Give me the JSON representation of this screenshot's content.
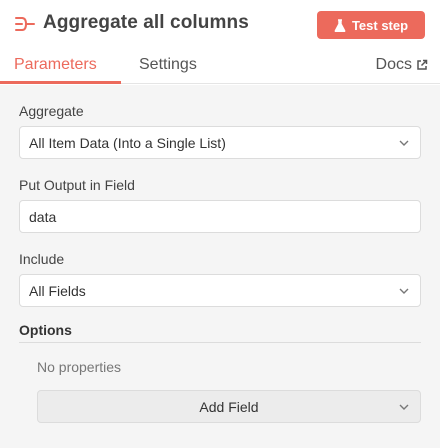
{
  "node": {
    "title": "Aggregate all columns",
    "icon": "aggregate-icon",
    "test_button_label": "Test step",
    "test_button_icon": "flask-icon"
  },
  "tabs": [
    {
      "label": "Parameters",
      "active": true
    },
    {
      "label": "Settings",
      "active": false
    }
  ],
  "docs": {
    "label": "Docs",
    "icon": "external-link-icon"
  },
  "fields": {
    "aggregate": {
      "label": "Aggregate",
      "value": "All Item Data (Into a Single List)"
    },
    "output_field": {
      "label": "Put Output in Field",
      "value": "data"
    },
    "include": {
      "label": "Include",
      "value": "All Fields"
    }
  },
  "options": {
    "label": "Options",
    "empty_text": "No properties",
    "add_field_label": "Add Field"
  },
  "colors": {
    "accent": "#ec6a5c",
    "panel_bg": "#f5f5f5"
  }
}
